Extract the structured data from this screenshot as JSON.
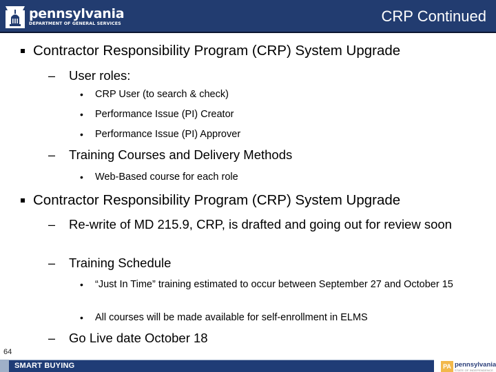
{
  "header": {
    "logo": {
      "name": "pennsylvania",
      "department": "DEPARTMENT OF GENERAL SERVICES",
      "icon": "keystone-capitol-icon"
    },
    "title": "CRP Continued"
  },
  "colors": {
    "header_bg": "#223c70",
    "footer_bg": "#1f3c76",
    "footer_stripe": "#9fb0c8",
    "text": "#000000",
    "pa_badge": "#f2b84a"
  },
  "content": {
    "section1": {
      "heading": "Contractor Responsibility Program (CRP) System Upgrade",
      "items": [
        {
          "label": "User roles:",
          "subitems": [
            "CRP User (to search & check)",
            "Performance Issue (PI) Creator",
            "Performance Issue (PI) Approver"
          ]
        },
        {
          "label": "Training Courses and Delivery Methods",
          "subitems": [
            "Web-Based course for each role"
          ]
        }
      ]
    },
    "section2": {
      "heading": "Contractor Responsibility Program (CRP) System Upgrade",
      "items": [
        {
          "label": "Re-write of MD 215.9, CRP, is drafted and going out for review soon",
          "subitems": []
        },
        {
          "label": "Training Schedule",
          "subitems": [
            "“Just In Time” training estimated to occur between September 27 and October 15",
            "All courses will be made available for self-enrollment in ELMS"
          ]
        },
        {
          "label": "Go Live date October 18",
          "subitems": []
        }
      ]
    },
    "markers": {
      "level2": "–",
      "level3": "•"
    }
  },
  "footer": {
    "page_number": "64",
    "label": "SMART BUYING",
    "logo": {
      "badge": "PA",
      "name": "pennsylvania",
      "tagline": "STATE OF INDEPENDENCE"
    }
  }
}
